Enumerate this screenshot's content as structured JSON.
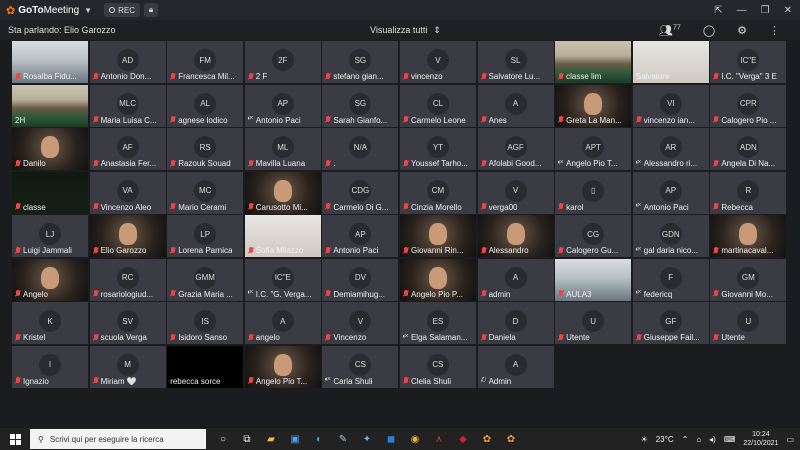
{
  "app": {
    "brand_bold": "GoTo",
    "brand_thin": "Meeting",
    "rec_label": "REC",
    "window_controls": [
      "⇱",
      "—",
      "❐",
      "✕"
    ]
  },
  "toolbar": {
    "speaking": "Sta parlando: Elio Garozzo",
    "view_all": "Visualizza tutti",
    "attendee_count": "77"
  },
  "participants": [
    {
      "name": "Rosalba Fidu...",
      "mic": "muted",
      "video": "room"
    },
    {
      "name": "Antonio Don...",
      "initials": "AD",
      "mic": "muted"
    },
    {
      "name": "Francesca Mil...",
      "initials": "FM",
      "mic": "muted"
    },
    {
      "name": "2 F",
      "initials": "2F",
      "mic": "muted"
    },
    {
      "name": "stefano gian...",
      "initials": "SG",
      "mic": "muted"
    },
    {
      "name": "vincenzo",
      "initials": "V",
      "mic": "muted"
    },
    {
      "name": "Salvatore Lu...",
      "initials": "SL",
      "mic": "muted"
    },
    {
      "name": "classe lim",
      "mic": "muted",
      "video": "classroom"
    },
    {
      "name": "Salvatore",
      "mic": "none",
      "video": "light"
    },
    {
      "name": "I.C. \"Verga\" 3 E",
      "initials": "IC\"E",
      "mic": "muted"
    },
    {
      "name": "2H",
      "mic": "none",
      "video": "classroom"
    },
    {
      "name": "Maria Luisa C...",
      "initials": "MLC",
      "mic": "muted"
    },
    {
      "name": "agnese lodico",
      "initials": "AL",
      "mic": "muted"
    },
    {
      "name": "Antonio Paci",
      "initials": "AP",
      "mic": "speaker"
    },
    {
      "name": "Sarah Gianfo...",
      "initials": "SG",
      "mic": "muted"
    },
    {
      "name": "Carmelo Leone",
      "initials": "CL",
      "mic": "muted"
    },
    {
      "name": "Anes",
      "initials": "A",
      "mic": "muted"
    },
    {
      "name": "Greta La Man...",
      "mic": "muted",
      "video": "face"
    },
    {
      "name": "vincenzo ian...",
      "initials": "VI",
      "mic": "muted"
    },
    {
      "name": "Calogero Pio ...",
      "initials": "CPR",
      "mic": "muted"
    },
    {
      "name": "Danilo",
      "mic": "muted",
      "video": "face"
    },
    {
      "name": "Anastasia Fer...",
      "initials": "AF",
      "mic": "muted"
    },
    {
      "name": "Razouk Souad",
      "initials": "RS",
      "mic": "muted"
    },
    {
      "name": "Mavilla Luana",
      "initials": "ML",
      "mic": "muted"
    },
    {
      "name": ".",
      "initials": "N/A",
      "mic": "muted"
    },
    {
      "name": "Youssef Tarho...",
      "initials": "YT",
      "mic": "muted"
    },
    {
      "name": "Afolabi Good...",
      "initials": "AGF",
      "mic": "muted"
    },
    {
      "name": "Angelo Pio T...",
      "initials": "APT",
      "mic": "speaker"
    },
    {
      "name": "Alessandro ri...",
      "initials": "AR",
      "mic": "speaker"
    },
    {
      "name": "Angela Di Na...",
      "initials": "ADN",
      "mic": "muted"
    },
    {
      "name": "classe",
      "mic": "muted",
      "video": "green"
    },
    {
      "name": "Vincenzo Aleo",
      "initials": "VA",
      "mic": "muted"
    },
    {
      "name": "Mario Cerami",
      "initials": "MC",
      "mic": "muted"
    },
    {
      "name": "Carusotto Mi...",
      "mic": "muted",
      "video": "face"
    },
    {
      "name": "Carmelo Di G...",
      "initials": "CDG",
      "mic": "muted"
    },
    {
      "name": "Cinzia Morello",
      "initials": "CM",
      "mic": "muted"
    },
    {
      "name": "verga00",
      "initials": "V",
      "mic": "muted"
    },
    {
      "name": "karol",
      "initials": "▯",
      "mic": "muted"
    },
    {
      "name": "Antonio Paci",
      "initials": "AP",
      "mic": "speaker"
    },
    {
      "name": "Rebecca",
      "initials": "R",
      "mic": "muted"
    },
    {
      "name": "Luigi Jammali",
      "initials": "LJ",
      "mic": "muted"
    },
    {
      "name": "Elio Garozzo",
      "mic": "muted",
      "video": "face"
    },
    {
      "name": "Lorena Parnica",
      "initials": "LP",
      "mic": "muted"
    },
    {
      "name": "Sofia Milazzo",
      "mic": "muted",
      "video": "light"
    },
    {
      "name": "Antonio Paci",
      "initials": "AP",
      "mic": "muted"
    },
    {
      "name": "Giovanni Rin...",
      "mic": "muted",
      "video": "face"
    },
    {
      "name": "Alessandro",
      "mic": "muted",
      "video": "face"
    },
    {
      "name": "Calogero Gu...",
      "initials": "CG",
      "mic": "muted"
    },
    {
      "name": "gal daria nico...",
      "initials": "GDN",
      "mic": "speaker"
    },
    {
      "name": "martinacaval...",
      "mic": "muted",
      "video": "face"
    },
    {
      "name": "Angelo",
      "mic": "muted",
      "video": "face"
    },
    {
      "name": "rosariologiud...",
      "initials": "RC",
      "mic": "muted"
    },
    {
      "name": "Grazia Maria ...",
      "initials": "GMM",
      "mic": "muted"
    },
    {
      "name": "I.C. \"G. Verga...",
      "initials": "IC\"E",
      "mic": "speaker"
    },
    {
      "name": "Demiamihug...",
      "initials": "DV",
      "mic": "muted"
    },
    {
      "name": "Angelo Pio P...",
      "mic": "muted",
      "video": "face"
    },
    {
      "name": "admin",
      "initials": "A",
      "mic": "muted"
    },
    {
      "name": "AULA3",
      "mic": "muted",
      "video": "room"
    },
    {
      "name": "federicq",
      "initials": "F",
      "mic": "speaker"
    },
    {
      "name": "Giovanni Mo...",
      "initials": "GM",
      "mic": "muted"
    },
    {
      "name": "Kristel",
      "initials": "K",
      "mic": "muted"
    },
    {
      "name": "scuola Verga",
      "initials": "SV",
      "mic": "muted"
    },
    {
      "name": "Isidoro Sanso",
      "initials": "IS",
      "mic": "muted"
    },
    {
      "name": "angelo",
      "initials": "A",
      "mic": "muted"
    },
    {
      "name": "Vincenzo",
      "initials": "V",
      "mic": "muted"
    },
    {
      "name": "Elga Salaman...",
      "initials": "ES",
      "mic": "speaker"
    },
    {
      "name": "Daniela",
      "initials": "D",
      "mic": "muted"
    },
    {
      "name": "Utente",
      "initials": "U",
      "mic": "muted"
    },
    {
      "name": "Giuseppe Fail...",
      "initials": "GF",
      "mic": "muted"
    },
    {
      "name": "Utente",
      "initials": "U",
      "mic": "muted"
    },
    {
      "name": "Ignazio",
      "initials": "I",
      "mic": "muted"
    },
    {
      "name": "Miriam 🤍",
      "initials": "M",
      "mic": "muted"
    },
    {
      "name": "rebecca sorce",
      "mic": "none",
      "video": "dark"
    },
    {
      "name": "Angelo Pio T...",
      "mic": "muted",
      "video": "face"
    },
    {
      "name": "Carla Shuli",
      "initials": "CS",
      "mic": "speaker"
    },
    {
      "name": "Clelia Shuli",
      "initials": "CS",
      "mic": "muted"
    },
    {
      "name": "Admin",
      "initials": "A",
      "mic": "phone"
    }
  ],
  "taskbar": {
    "search_placeholder": "Scrivi qui per eseguire la ricerca",
    "weather": "23°C",
    "time": "10:24",
    "date": "22/10/2021"
  }
}
